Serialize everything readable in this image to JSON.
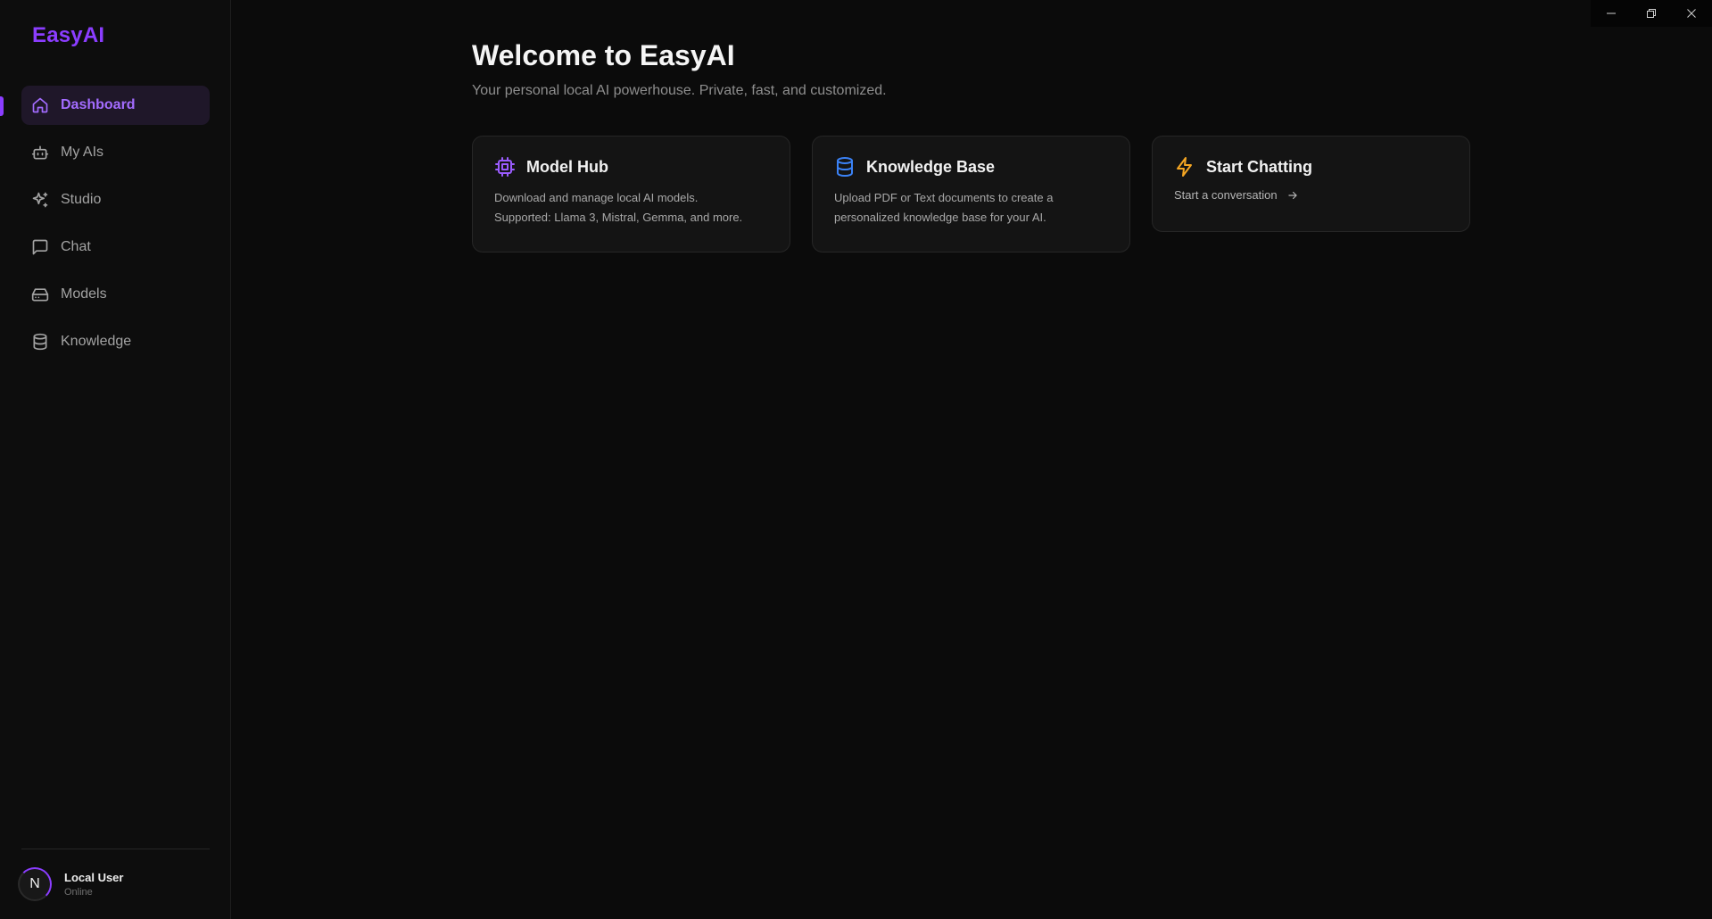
{
  "app": {
    "brand": "EasyAI"
  },
  "sidebar": {
    "items": [
      {
        "label": "Dashboard",
        "icon": "home-icon",
        "active": true
      },
      {
        "label": "My AIs",
        "icon": "bot-icon"
      },
      {
        "label": "Studio",
        "icon": "sparkles-icon"
      },
      {
        "label": "Chat",
        "icon": "message-square-icon"
      },
      {
        "label": "Models",
        "icon": "hard-drive-icon"
      },
      {
        "label": "Knowledge",
        "icon": "database-icon"
      }
    ],
    "user": {
      "initial": "N",
      "name": "Local User",
      "status": "Online"
    }
  },
  "main": {
    "title": "Welcome to EasyAI",
    "subtitle": "Your personal local AI powerhouse. Private, fast, and customized.",
    "cards": [
      {
        "title": "Model Hub",
        "icon": "cpu-icon",
        "icon_color": "#9b5cff",
        "desc_line1": "Download and manage local AI models.",
        "desc_line2": "Supported: Llama 3, Mistral, Gemma, and more."
      },
      {
        "title": "Knowledge Base",
        "icon": "database-icon",
        "icon_color": "#3b82f6",
        "desc_line1": "Upload PDF or Text documents to create a",
        "desc_line2": "personalized knowledge base for your AI."
      },
      {
        "title": "Start Chatting",
        "icon": "zap-icon",
        "icon_color": "#f5a623",
        "link": "Start a conversation"
      }
    ]
  },
  "colors": {
    "accent": "#8b3dff",
    "background": "#0b0b0b",
    "card": "#141414"
  }
}
